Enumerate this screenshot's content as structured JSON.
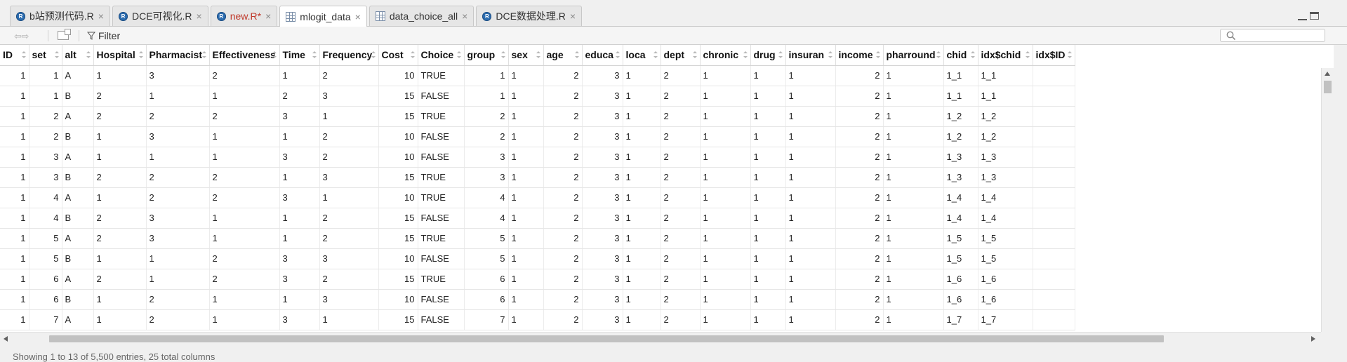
{
  "tabs": [
    {
      "label": "b站预测代码.R",
      "icon": "r-file-icon",
      "modified": false,
      "active": false
    },
    {
      "label": "DCE可视化.R",
      "icon": "r-file-icon",
      "modified": false,
      "active": false
    },
    {
      "label": "new.R*",
      "icon": "r-file-icon",
      "modified": true,
      "active": false
    },
    {
      "label": "mlogit_data",
      "icon": "data-grid-icon",
      "modified": false,
      "active": true
    },
    {
      "label": "data_choice_all",
      "icon": "data-grid-icon",
      "modified": false,
      "active": false
    },
    {
      "label": "DCE数据处理.R",
      "icon": "r-file-icon",
      "modified": false,
      "active": false
    }
  ],
  "toolbar": {
    "filter_label": "Filter",
    "search_placeholder": ""
  },
  "table": {
    "columns": [
      "ID",
      "set",
      "alt",
      "Hospital",
      "Pharmacist",
      "Effectiveness",
      "Time",
      "Frequency",
      "Cost",
      "Choice",
      "group",
      "sex",
      "age",
      "educa",
      "loca",
      "dept",
      "chronic",
      "drug",
      "insuran",
      "income",
      "pharround",
      "chid",
      "idx$chid",
      "idx$ID"
    ],
    "rows": [
      [
        "1",
        "1",
        "A",
        "1",
        "3",
        "2",
        "1",
        "2",
        "10",
        "TRUE",
        "1",
        "1",
        "2",
        "3",
        "1",
        "2",
        "1",
        "1",
        "1",
        "2",
        "1",
        "1_1",
        "1_1",
        ""
      ],
      [
        "1",
        "1",
        "B",
        "2",
        "1",
        "1",
        "2",
        "3",
        "15",
        "FALSE",
        "1",
        "1",
        "2",
        "3",
        "1",
        "2",
        "1",
        "1",
        "1",
        "2",
        "1",
        "1_1",
        "1_1",
        ""
      ],
      [
        "1",
        "2",
        "A",
        "2",
        "2",
        "2",
        "3",
        "1",
        "15",
        "TRUE",
        "2",
        "1",
        "2",
        "3",
        "1",
        "2",
        "1",
        "1",
        "1",
        "2",
        "1",
        "1_2",
        "1_2",
        ""
      ],
      [
        "1",
        "2",
        "B",
        "1",
        "3",
        "1",
        "1",
        "2",
        "10",
        "FALSE",
        "2",
        "1",
        "2",
        "3",
        "1",
        "2",
        "1",
        "1",
        "1",
        "2",
        "1",
        "1_2",
        "1_2",
        ""
      ],
      [
        "1",
        "3",
        "A",
        "1",
        "1",
        "1",
        "3",
        "2",
        "10",
        "FALSE",
        "3",
        "1",
        "2",
        "3",
        "1",
        "2",
        "1",
        "1",
        "1",
        "2",
        "1",
        "1_3",
        "1_3",
        ""
      ],
      [
        "1",
        "3",
        "B",
        "2",
        "2",
        "2",
        "1",
        "3",
        "15",
        "TRUE",
        "3",
        "1",
        "2",
        "3",
        "1",
        "2",
        "1",
        "1",
        "1",
        "2",
        "1",
        "1_3",
        "1_3",
        ""
      ],
      [
        "1",
        "4",
        "A",
        "1",
        "2",
        "2",
        "3",
        "1",
        "10",
        "TRUE",
        "4",
        "1",
        "2",
        "3",
        "1",
        "2",
        "1",
        "1",
        "1",
        "2",
        "1",
        "1_4",
        "1_4",
        ""
      ],
      [
        "1",
        "4",
        "B",
        "2",
        "3",
        "1",
        "1",
        "2",
        "15",
        "FALSE",
        "4",
        "1",
        "2",
        "3",
        "1",
        "2",
        "1",
        "1",
        "1",
        "2",
        "1",
        "1_4",
        "1_4",
        ""
      ],
      [
        "1",
        "5",
        "A",
        "2",
        "3",
        "1",
        "1",
        "2",
        "15",
        "TRUE",
        "5",
        "1",
        "2",
        "3",
        "1",
        "2",
        "1",
        "1",
        "1",
        "2",
        "1",
        "1_5",
        "1_5",
        ""
      ],
      [
        "1",
        "5",
        "B",
        "1",
        "1",
        "2",
        "3",
        "3",
        "10",
        "FALSE",
        "5",
        "1",
        "2",
        "3",
        "1",
        "2",
        "1",
        "1",
        "1",
        "2",
        "1",
        "1_5",
        "1_5",
        ""
      ],
      [
        "1",
        "6",
        "A",
        "2",
        "1",
        "2",
        "3",
        "2",
        "15",
        "TRUE",
        "6",
        "1",
        "2",
        "3",
        "1",
        "2",
        "1",
        "1",
        "1",
        "2",
        "1",
        "1_6",
        "1_6",
        ""
      ],
      [
        "1",
        "6",
        "B",
        "1",
        "2",
        "1",
        "1",
        "3",
        "10",
        "FALSE",
        "6",
        "1",
        "2",
        "3",
        "1",
        "2",
        "1",
        "1",
        "1",
        "2",
        "1",
        "1_6",
        "1_6",
        ""
      ],
      [
        "1",
        "7",
        "A",
        "1",
        "2",
        "1",
        "3",
        "1",
        "15",
        "FALSE",
        "7",
        "1",
        "2",
        "3",
        "1",
        "2",
        "1",
        "1",
        "1",
        "2",
        "1",
        "1_7",
        "1_7",
        ""
      ]
    ]
  },
  "status": {
    "text": "Showing 1 to 13 of 5,500 entries, 25 total columns"
  }
}
